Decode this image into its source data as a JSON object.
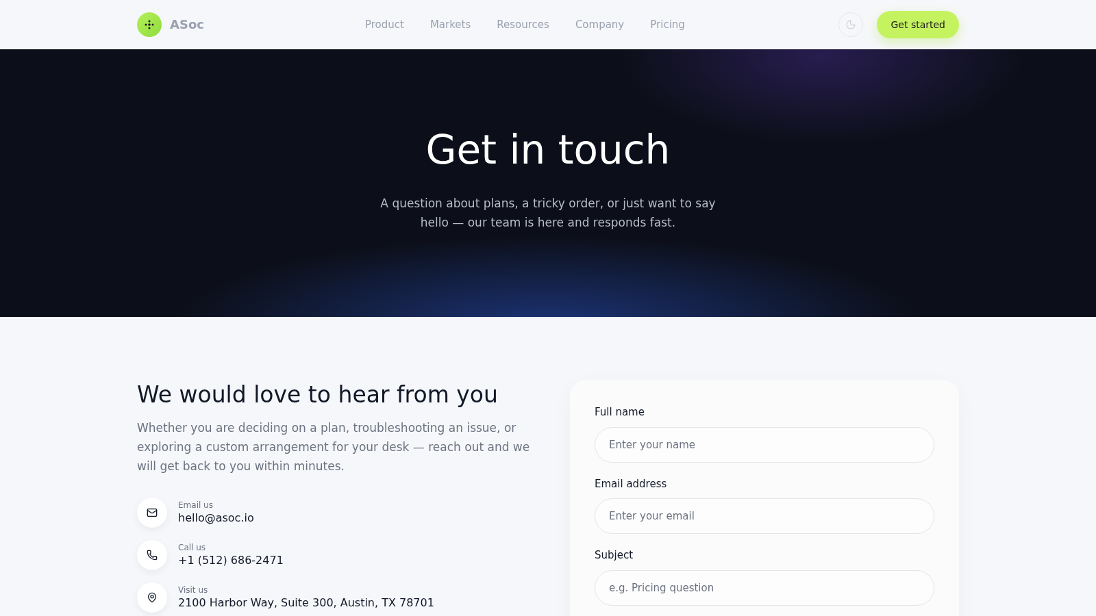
{
  "header": {
    "brand": "ASoc",
    "nav": [
      {
        "label": "Product"
      },
      {
        "label": "Markets"
      },
      {
        "label": "Resources"
      },
      {
        "label": "Company"
      },
      {
        "label": "Pricing"
      }
    ],
    "cta": "Get started"
  },
  "hero": {
    "title": "Get in touch",
    "subtitle": "A question about plans, a tricky order, or just want to say hello — our team is here and responds fast."
  },
  "intro": {
    "title": "We would love to hear from you",
    "body": "Whether you are deciding on a plan, troubleshooting an issue, or exploring a custom arrangement for your desk — reach out and we will get back to you within minutes."
  },
  "contacts": [
    {
      "kind": "email",
      "label": "Email us",
      "value": "hello@asoc.io"
    },
    {
      "kind": "phone",
      "label": "Call us",
      "value": "+1 (512) 686-2471"
    },
    {
      "kind": "location",
      "label": "Visit us",
      "value": "2100 Harbor Way, Suite 300, Austin, TX 78701"
    }
  ],
  "form": {
    "fields": [
      {
        "label": "Full name",
        "placeholder": "Enter your name"
      },
      {
        "label": "Email address",
        "placeholder": "Enter your email"
      },
      {
        "label": "Subject",
        "placeholder": "e.g. Pricing question"
      }
    ]
  }
}
